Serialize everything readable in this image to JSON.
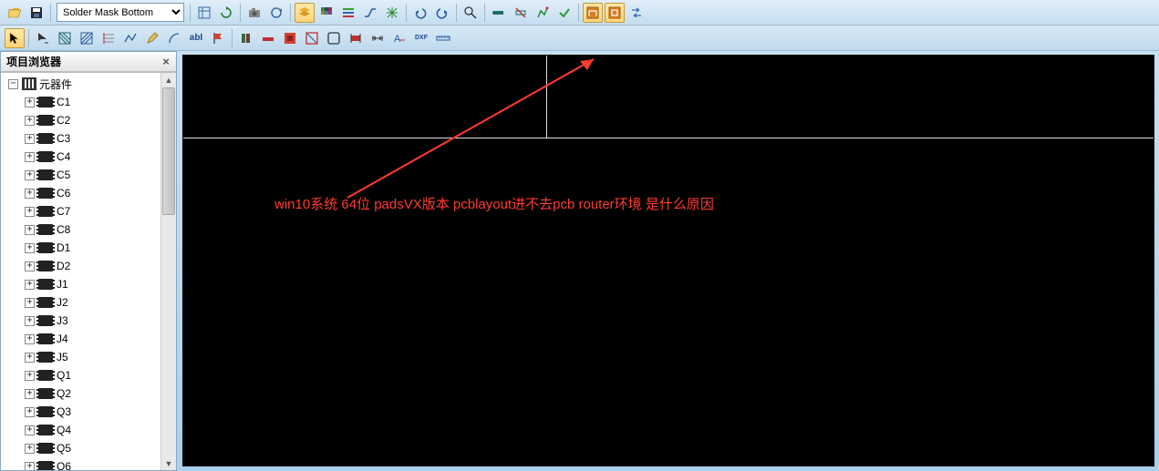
{
  "toolbar1": {
    "layer_selected": "Solder Mask Bottom"
  },
  "panel": {
    "title": "项目浏览器",
    "root_label": "元器件",
    "items": [
      "C1",
      "C2",
      "C3",
      "C4",
      "C5",
      "C6",
      "C7",
      "C8",
      "D1",
      "D2",
      "J1",
      "J2",
      "J3",
      "J4",
      "J5",
      "Q1",
      "Q2",
      "Q3",
      "Q4",
      "Q5",
      "Q6"
    ]
  },
  "annotation": {
    "text": "win10系统  64位 padsVX版本 pcblayout进不去pcb router环境  是什么原因"
  },
  "icons": {
    "abl": "abI",
    "dxf": "DXF"
  }
}
